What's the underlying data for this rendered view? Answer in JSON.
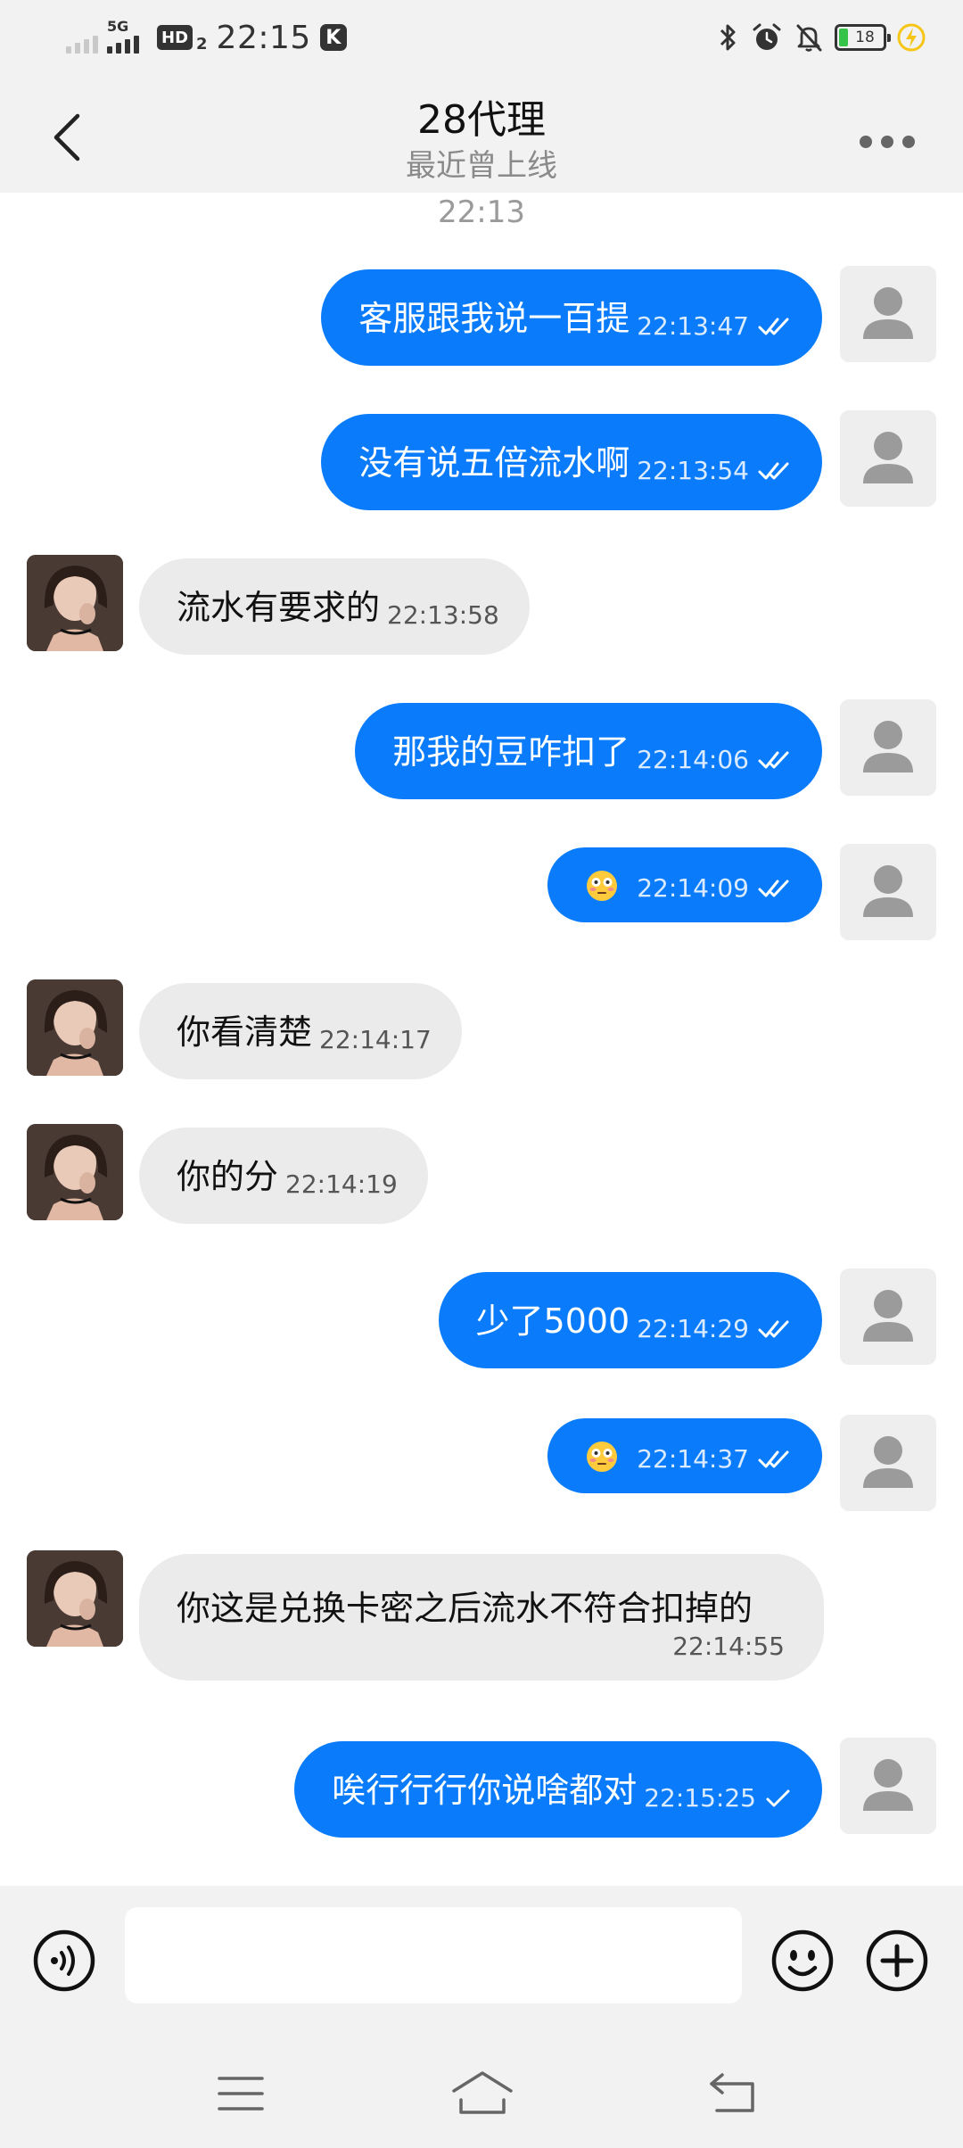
{
  "status_bar": {
    "network": "5G",
    "hd": "HD",
    "hd_sub": "2",
    "time": "22:15",
    "app_badge": "K",
    "battery": "18"
  },
  "header": {
    "title": "28代理",
    "subtitle": "最近曾上线"
  },
  "chat": {
    "time_separator": "22:13",
    "messages": [
      {
        "side": "me",
        "text": "客服跟我说一百提",
        "time": "22:13:47"
      },
      {
        "side": "me",
        "text": "没有说五倍流水啊",
        "time": "22:13:54"
      },
      {
        "side": "peer",
        "text": "流水有要求的",
        "time": "22:13:58"
      },
      {
        "side": "me",
        "text": "那我的豆咋扣了",
        "time": "22:14:06"
      },
      {
        "side": "me",
        "text": "",
        "emoji": "flushed-face",
        "time": "22:14:09"
      },
      {
        "side": "peer",
        "text": "你看清楚",
        "time": "22:14:17"
      },
      {
        "side": "peer",
        "text": "你的分",
        "time": "22:14:19"
      },
      {
        "side": "me",
        "text": "少了5000",
        "time": "22:14:29"
      },
      {
        "side": "me",
        "text": "",
        "emoji": "flushed-face",
        "time": "22:14:37"
      },
      {
        "side": "peer",
        "text": "你这是兑换卡密之后流水不符合扣掉的",
        "time": "22:14:55"
      },
      {
        "side": "me",
        "text": "唉行行行你说啥都对",
        "time": "22:15:25"
      }
    ]
  },
  "input": {
    "placeholder": ""
  },
  "icons": {
    "back": "chevron-left-icon",
    "more": "more-horizontal-icon",
    "voice": "voice-icon",
    "emoji": "smiley-icon",
    "plus": "plus-circle-icon",
    "menu": "menu-icon",
    "home": "home-icon",
    "return": "return-icon"
  },
  "colors": {
    "accent": "#0a7cfb",
    "peer_bubble": "#ebebeb",
    "bar_background": "#f2f2f2",
    "battery_green": "#36c34a",
    "charging_yellow": "#f5c518"
  }
}
